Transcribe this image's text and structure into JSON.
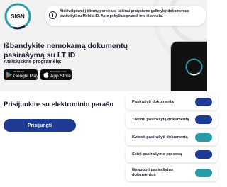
{
  "app": {
    "logo_text": "SIGN",
    "logo_caption": "Patvirtinta LT ID",
    "accent": "#1f3a93",
    "brand_teal": "#2b9aa8",
    "dark_button": "#0d0d0d"
  },
  "notice": {
    "icon": "info-icon",
    "text": "Atsižvelgdami į klientų poreikius, laikinai pratęsiame galimybę dokumentus pasirašyti su Mobile-ID. Apie pokyčius praneš ime iš anksto."
  },
  "hero": {
    "headline": "Išbandykite nemokamą dokumentų pasirašymą su LT ID",
    "download_label": "Atsisiųskite programėlę:",
    "stores": [
      {
        "small": "GET IT ON",
        "big": "Google Play",
        "icon": "google-play-icon"
      },
      {
        "small": "Download on the",
        "big": "App Store",
        "icon": "apple-icon"
      }
    ]
  },
  "login": {
    "title": "Prisijunkite su elektroniniu parašu",
    "button_label": "Prisijungti"
  },
  "features": [
    {
      "label": "Pasirašyti dokumentą",
      "toggle_color": "#1f3a93"
    },
    {
      "label": "Tikrinti pasirašytą dokumentą",
      "toggle_color": "#1f3a93"
    },
    {
      "label": "Kviesti pasirašyti dokumentą",
      "toggle_color": "#2b9aa8"
    },
    {
      "label": "Sekti pasirašymo procesą",
      "toggle_color": "#1f3a93"
    },
    {
      "label": "Išsaugoti pasirašytus dokumentus",
      "toggle_color": "#2b9aa8"
    }
  ]
}
